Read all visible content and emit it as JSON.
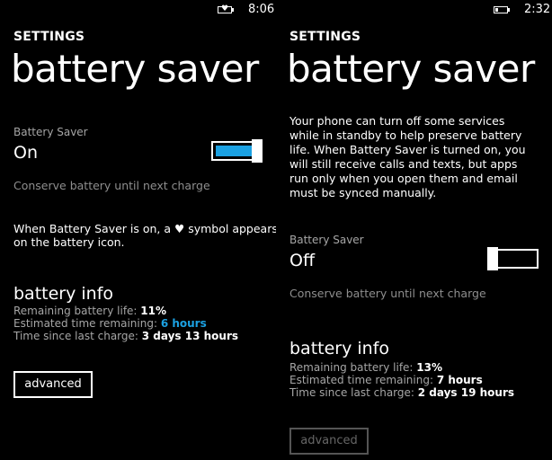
{
  "left": {
    "status": {
      "time": "8:06",
      "battery_saver_symbol": "heart-icon"
    },
    "header": {
      "settings_label": "SETTINGS",
      "title": "battery saver"
    },
    "battery_saver": {
      "label": "Battery Saver",
      "value": "On",
      "toggle_on": true
    },
    "conserve_text": "Conserve battery until next charge",
    "note": {
      "before_symbol": "When Battery Saver is on, a ",
      "after_symbol": " symbol appears",
      "line2": "on the battery icon."
    },
    "battery_info": {
      "title": "battery info",
      "remaining_label": "Remaining battery life: ",
      "remaining_value": "11%",
      "estimated_label": "Estimated time remaining: ",
      "estimated_value": "6 hours",
      "since_label": "Time since last charge: ",
      "since_value": "3 days 13 hours"
    },
    "advanced_button": "advanced"
  },
  "right": {
    "status": {
      "time": "2:32"
    },
    "header": {
      "settings_label": "SETTINGS",
      "title": "battery saver"
    },
    "description": [
      "Your phone can turn off some services",
      "while in standby to help preserve battery",
      "life. When Battery Saver is turned on, you",
      "will still receive calls and texts, but apps",
      "run only when you open them and email",
      "must be synced manually."
    ],
    "battery_saver": {
      "label": "Battery Saver",
      "value": "Off",
      "toggle_on": false
    },
    "conserve_text": "Conserve battery until next charge",
    "battery_info": {
      "title": "battery info",
      "remaining_label": "Remaining battery life: ",
      "remaining_value": "13%",
      "estimated_label": "Estimated time remaining: ",
      "estimated_value": "7 hours",
      "since_label": "Time since last charge: ",
      "since_value": "2 days 19 hours"
    },
    "advanced_button": "advanced"
  },
  "colors": {
    "accent": "#1ba1e2",
    "background": "#000000",
    "muted_text": "#8e8e8e"
  }
}
